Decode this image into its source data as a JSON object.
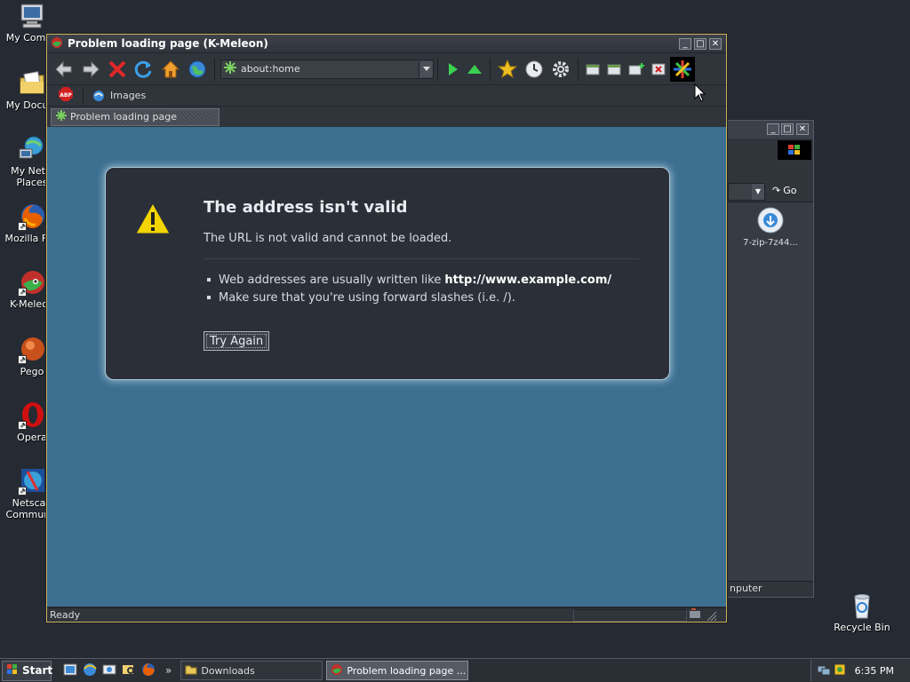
{
  "desktop": {
    "icons": [
      {
        "label": "My Compu",
        "icon": "computer-icon"
      },
      {
        "label": "My Docum",
        "icon": "documents-icon"
      },
      {
        "label": "My Netw Places",
        "icon": "network-icon"
      },
      {
        "label": "Mozilla Fire",
        "icon": "firefox-icon"
      },
      {
        "label": "K-Meleon",
        "icon": "kmeleon-icon"
      },
      {
        "label": "Pego",
        "icon": "pego-icon"
      },
      {
        "label": "Opera",
        "icon": "opera-icon"
      },
      {
        "label": "Netscap Communic",
        "icon": "netscape-icon"
      },
      {
        "label": "Recycle Bin",
        "icon": "recycle-bin-icon"
      }
    ]
  },
  "bgwindow": {
    "go_label": "Go",
    "file_label": "7-zip-7z44...",
    "status_text": "nputer"
  },
  "browser": {
    "title": "Problem loading page (K-Meleon)",
    "url_value": "about:home",
    "bookmarks": {
      "images_label": "Images"
    },
    "tab_label": "Problem loading page",
    "error": {
      "heading": "The address isn't valid",
      "description": "The URL is not valid and cannot be loaded.",
      "bullet1_text": "Web addresses are usually written like",
      "bullet1_example": "http://www.example.com/",
      "bullet2_text": "Make sure that you're using forward slashes (i.e. /).",
      "try_again": "Try Again"
    },
    "status": "Ready"
  },
  "taskbar": {
    "start_label": "Start",
    "tasks": [
      {
        "label": "Downloads"
      },
      {
        "label": "Problem loading page ..."
      }
    ],
    "clock": "6:35 PM"
  },
  "colors": {
    "content_bg": "#3c6f90",
    "error_box_bg": "#2b3038",
    "window_border": "#c8b060"
  }
}
